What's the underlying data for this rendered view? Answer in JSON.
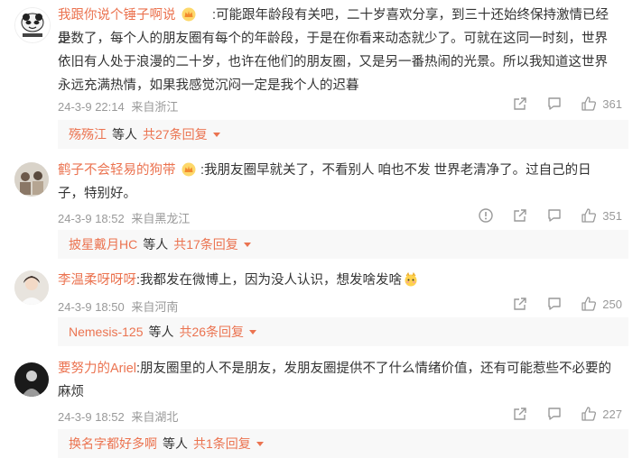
{
  "comments": [
    {
      "author": "我跟你说个锤子啊说",
      "text_lines": [
        ":可能跟年龄段有关吧，二十岁喜欢分享，到三十还始终保持激情已经是",
        "少数了，每个人的朋友圈有每个的年龄段，于是在你看来动态就少了。可就在这同一时刻，世界",
        "依旧有人处于浪漫的二十岁，也许在他们的朋友圈，又是另一番热闹的光景。所以我知道这世界",
        "永远充满热情，如果我感觉沉闷一定是我个人的迟暮"
      ],
      "date": "24-3-9 22:14",
      "location": "来自浙江",
      "likes": "361",
      "reply": {
        "user": "殇殇江",
        "etc": "等人",
        "total": "共27条回复"
      }
    },
    {
      "author": "鹤子不会轻易的狗带",
      "text_lines": [
        ":我朋友圈早就关了，不看别人 咱也不发 世界老清净了。过自己的日",
        "子，特别好。"
      ],
      "date": "24-3-9 18:52",
      "location": "来自黑龙江",
      "likes": "351",
      "reply": {
        "user": "披星戴月HC",
        "etc": "等人",
        "total": "共17条回复"
      }
    },
    {
      "author": "李温柔呀呀呀",
      "text_lines": [
        ":我都发在微博上，因为没人认识，想发啥发啥"
      ],
      "date": "24-3-9 18:50",
      "location": "来自河南",
      "likes": "250",
      "reply": {
        "user": "Nemesis-125",
        "etc": "等人",
        "total": "共26条回复"
      }
    },
    {
      "author": "要努力的Ariel",
      "text_lines": [
        ":朋友圈里的人不是朋友，发朋友圈提供不了什么情绪价值，还有可能惹些不必要的",
        "麻烦"
      ],
      "date": "24-3-9 18:52",
      "location": "来自湖北",
      "likes": "227",
      "reply": {
        "user": "换名字都好多啊",
        "etc": "等人",
        "total": "共1条回复"
      }
    }
  ],
  "colors": {
    "accent": "#eb7350",
    "meta": "#999999",
    "reply_bg": "#f8f8f8"
  }
}
